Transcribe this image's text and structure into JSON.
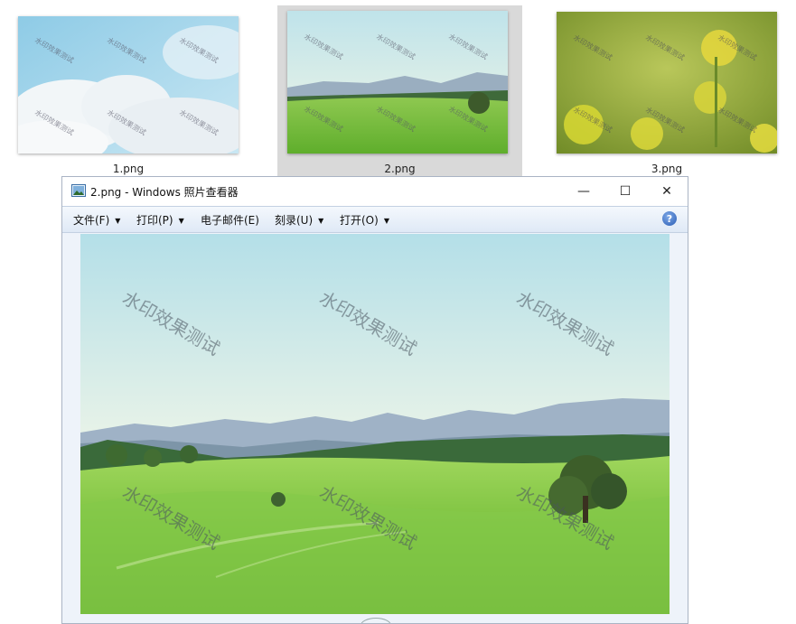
{
  "thumbnails": [
    {
      "name": "1.png",
      "watermark": "水印效果测试",
      "selected": false
    },
    {
      "name": "2.png",
      "watermark": "水印效果测试",
      "selected": true
    },
    {
      "name": "3.png",
      "watermark": "水印效果测试",
      "selected": false
    }
  ],
  "window": {
    "title": "2.png - Windows 照片查看器",
    "minimize_glyph": "—",
    "maximize_glyph": "☐",
    "close_glyph": "✕"
  },
  "menu": {
    "items": [
      "文件(F)",
      "打印(P)",
      "电子邮件(E)",
      "刻录(U)",
      "打开(O)"
    ],
    "help_glyph": "?"
  },
  "viewer": {
    "watermark": "水印效果测试"
  },
  "icons": {
    "app": "photo-viewer-icon",
    "help": "help-icon"
  }
}
